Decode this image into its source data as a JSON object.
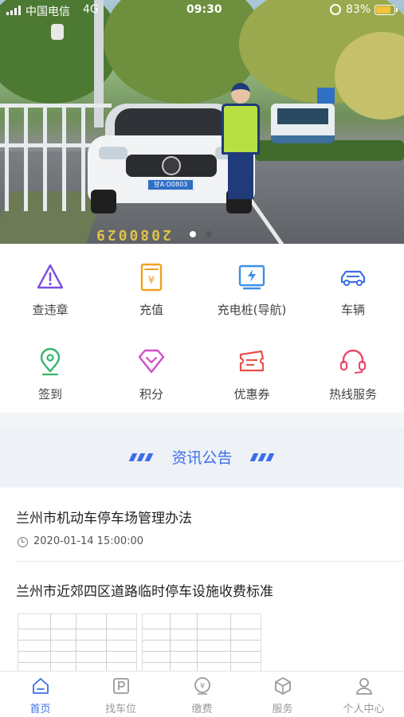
{
  "status_bar": {
    "carrier": "中国电信",
    "network": "4G",
    "time": "09:30",
    "battery_percent": "83%",
    "battery_level": 0.83
  },
  "banner": {
    "plate_text": "甘A·D0803",
    "road_number": "2080029",
    "carousel_dots": 2,
    "active_dot": 0
  },
  "menu": {
    "items": [
      {
        "label": "查违章",
        "icon": "warning-triangle-icon",
        "color": "#7b4fe0"
      },
      {
        "label": "充值",
        "icon": "yen-recharge-icon",
        "color": "#f0a020"
      },
      {
        "label": "充电桩(导航)",
        "icon": "charging-pile-icon",
        "color": "#3b8fe8"
      },
      {
        "label": "车辆",
        "icon": "car-icon",
        "color": "#3b6ee8"
      },
      {
        "label": "签到",
        "icon": "location-pin-icon",
        "color": "#33b56b"
      },
      {
        "label": "积分",
        "icon": "diamond-icon",
        "color": "#d04fc8"
      },
      {
        "label": "优惠券",
        "icon": "coupon-icon",
        "color": "#e8504a"
      },
      {
        "label": "热线服务",
        "icon": "headset-icon",
        "color": "#e84a6a"
      }
    ]
  },
  "news": {
    "header": "资讯公告",
    "items": [
      {
        "title": "兰州市机动车停车场管理办法",
        "date": "2020-01-14 15:00:00"
      },
      {
        "title": "兰州市近郊四区道路临时停车设施收费标准"
      }
    ]
  },
  "tabbar": {
    "tabs": [
      {
        "label": "首页",
        "icon": "home-icon",
        "active": true
      },
      {
        "label": "找车位",
        "icon": "parking-icon",
        "active": false
      },
      {
        "label": "缴费",
        "icon": "payment-icon",
        "active": false
      },
      {
        "label": "服务",
        "icon": "box-icon",
        "active": false
      },
      {
        "label": "个人中心",
        "icon": "user-icon",
        "active": false
      }
    ]
  },
  "colors": {
    "accent": "#3b6ee8",
    "tab_inactive": "#999999"
  }
}
